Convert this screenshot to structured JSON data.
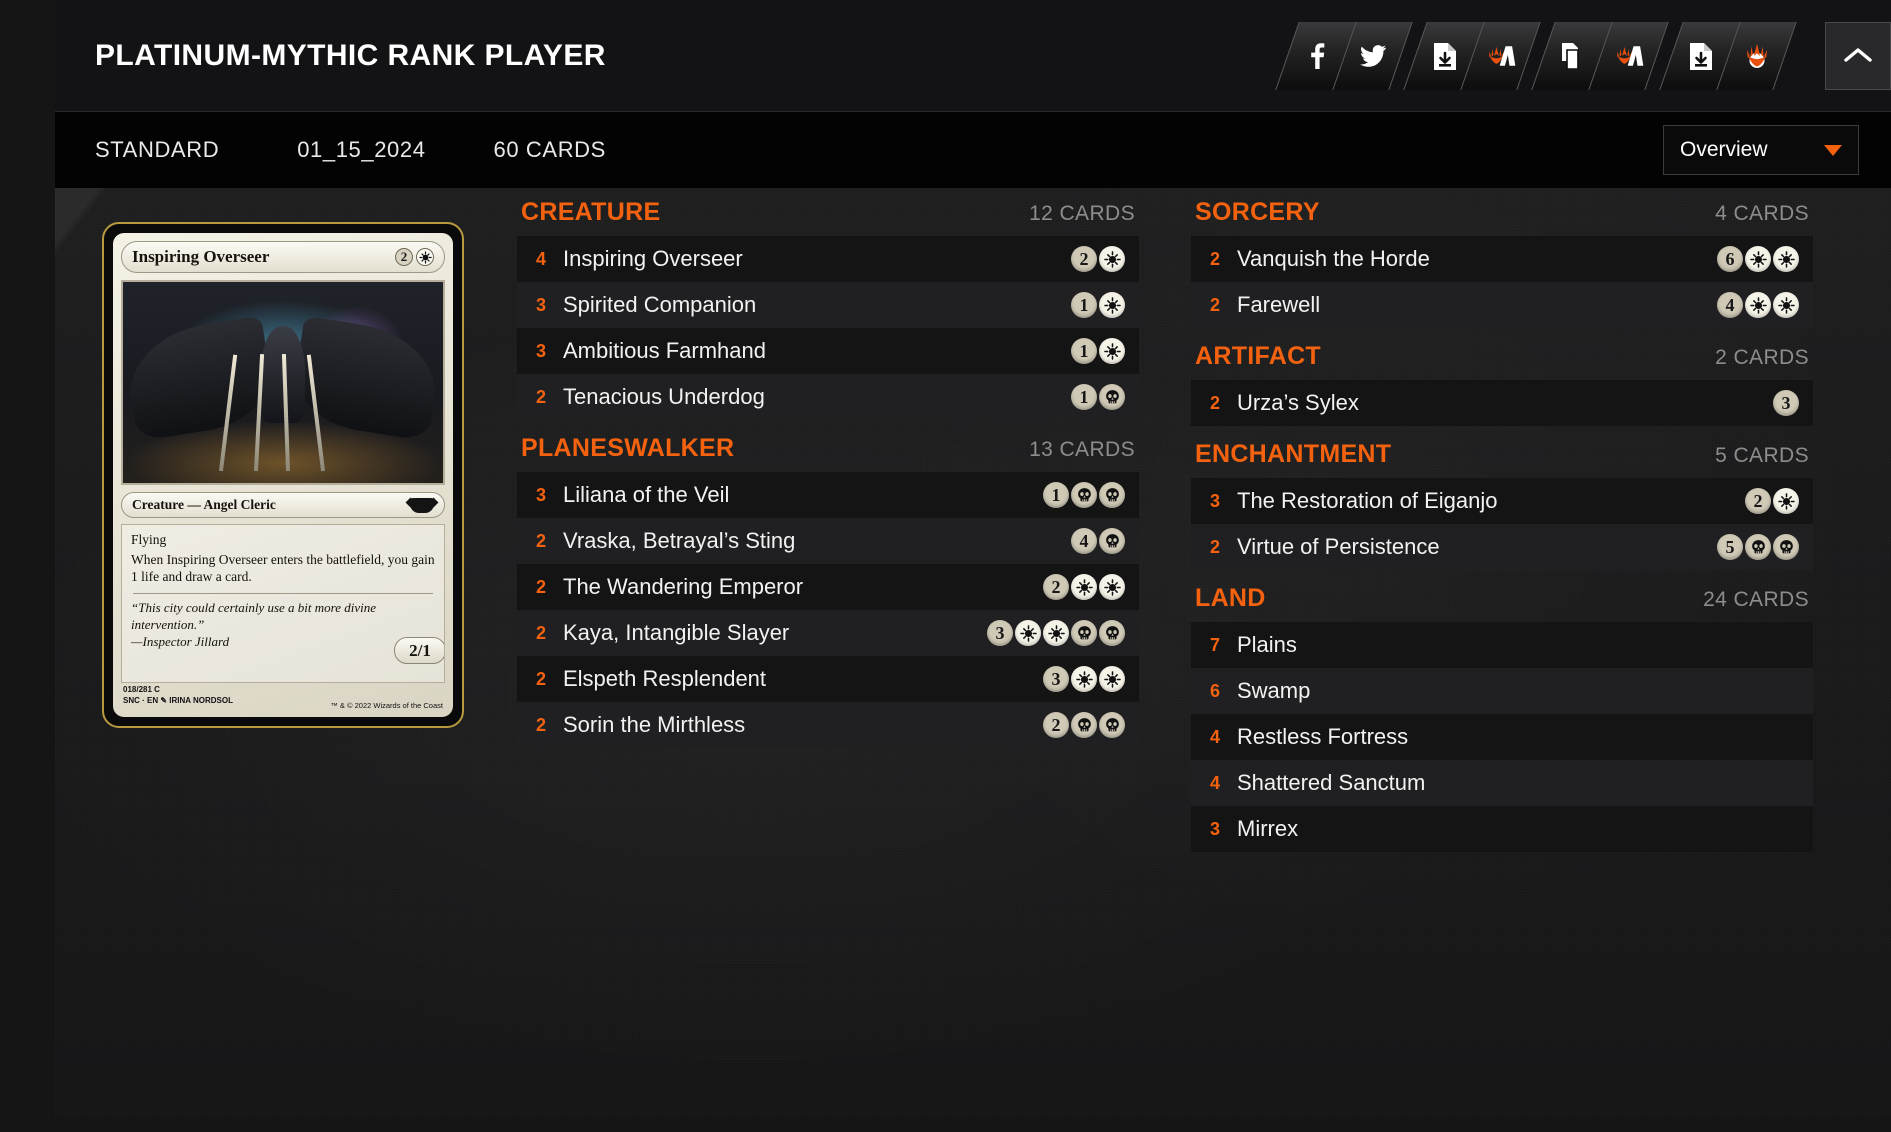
{
  "colors": {
    "accent": "#f4620f",
    "title_text": "#ffffff",
    "count_text": "#8d8d8d",
    "row_dark": "#141415",
    "row_light": "#202022",
    "titlebar_bg": "#131315",
    "metabar_bg": "#030303",
    "card_border": "#b8993f"
  },
  "header": {
    "title": "PLATINUM-MYTHIC RANK PLAYER",
    "icons": [
      {
        "name": "facebook-share-icon",
        "glyph": "facebook"
      },
      {
        "name": "twitter-share-icon",
        "glyph": "twitter"
      },
      {
        "name": "export-deck-file-icon",
        "glyph": "file-download"
      },
      {
        "name": "mtg-arena-import-icon",
        "glyph": "mtg-planeswalker"
      },
      {
        "name": "copy-decklist-icon",
        "glyph": "copy"
      },
      {
        "name": "mtg-arena-copy-icon",
        "glyph": "mtg-planeswalker"
      },
      {
        "name": "download-decklist-icon",
        "glyph": "file-download"
      },
      {
        "name": "mtg-arena-download-icon",
        "glyph": "mtg-planeswalker-flame"
      }
    ],
    "collapse_label": "collapse-panel"
  },
  "meta": {
    "format": "STANDARD",
    "date": "01_15_2024",
    "card_count": "60 CARDS",
    "view_selected": "Overview",
    "view_options": [
      "Overview"
    ]
  },
  "preview_card": {
    "name": "Inspiring Overseer",
    "mana_cost": [
      {
        "type": "generic",
        "value": "2"
      },
      {
        "type": "white"
      }
    ],
    "type_line": "Creature — Angel Cleric",
    "rules": [
      "Flying",
      "When Inspiring Overseer enters the battlefield, you gain 1 life and draw a card."
    ],
    "flavor": "“This city could certainly use a bit more divine intervention.”",
    "flavor_attribution": "—Inspector Jillard",
    "power_toughness": "2/1",
    "collector_number": "018/281",
    "rarity": "C",
    "set_lang": "SNC · EN",
    "artist": "IRINA NORDSOL",
    "copyright": "™ & © 2022 Wizards of the Coast"
  },
  "columns": [
    {
      "sections": [
        {
          "title": "CREATURE",
          "count": "12 CARDS",
          "cards": [
            {
              "qty": "4",
              "name": "Inspiring Overseer",
              "cost": [
                {
                  "type": "generic",
                  "value": "2"
                },
                {
                  "type": "white"
                }
              ]
            },
            {
              "qty": "3",
              "name": "Spirited Companion",
              "cost": [
                {
                  "type": "generic",
                  "value": "1"
                },
                {
                  "type": "white"
                }
              ]
            },
            {
              "qty": "3",
              "name": "Ambitious Farmhand",
              "cost": [
                {
                  "type": "generic",
                  "value": "1"
                },
                {
                  "type": "white"
                }
              ]
            },
            {
              "qty": "2",
              "name": "Tenacious Underdog",
              "cost": [
                {
                  "type": "generic",
                  "value": "1"
                },
                {
                  "type": "black"
                }
              ]
            }
          ]
        },
        {
          "title": "PLANESWALKER",
          "count": "13 CARDS",
          "cards": [
            {
              "qty": "3",
              "name": "Liliana of the Veil",
              "cost": [
                {
                  "type": "generic",
                  "value": "1"
                },
                {
                  "type": "black"
                },
                {
                  "type": "black"
                }
              ]
            },
            {
              "qty": "2",
              "name": "Vraska, Betrayal’s Sting",
              "cost": [
                {
                  "type": "generic",
                  "value": "4"
                },
                {
                  "type": "black"
                }
              ]
            },
            {
              "qty": "2",
              "name": "The Wandering Emperor",
              "cost": [
                {
                  "type": "generic",
                  "value": "2"
                },
                {
                  "type": "white"
                },
                {
                  "type": "white"
                }
              ]
            },
            {
              "qty": "2",
              "name": "Kaya, Intangible Slayer",
              "cost": [
                {
                  "type": "generic",
                  "value": "3"
                },
                {
                  "type": "white"
                },
                {
                  "type": "white"
                },
                {
                  "type": "black"
                },
                {
                  "type": "black"
                }
              ]
            },
            {
              "qty": "2",
              "name": "Elspeth Resplendent",
              "cost": [
                {
                  "type": "generic",
                  "value": "3"
                },
                {
                  "type": "white"
                },
                {
                  "type": "white"
                }
              ]
            },
            {
              "qty": "2",
              "name": "Sorin the Mirthless",
              "cost": [
                {
                  "type": "generic",
                  "value": "2"
                },
                {
                  "type": "black"
                },
                {
                  "type": "black"
                }
              ]
            }
          ]
        }
      ]
    },
    {
      "sections": [
        {
          "title": "SORCERY",
          "count": "4 CARDS",
          "cards": [
            {
              "qty": "2",
              "name": "Vanquish the Horde",
              "cost": [
                {
                  "type": "generic",
                  "value": "6"
                },
                {
                  "type": "white"
                },
                {
                  "type": "white"
                }
              ]
            },
            {
              "qty": "2",
              "name": "Farewell",
              "cost": [
                {
                  "type": "generic",
                  "value": "4"
                },
                {
                  "type": "white"
                },
                {
                  "type": "white"
                }
              ]
            }
          ]
        },
        {
          "title": "ARTIFACT",
          "count": "2 CARDS",
          "cards": [
            {
              "qty": "2",
              "name": "Urza’s Sylex",
              "cost": [
                {
                  "type": "generic",
                  "value": "3"
                }
              ]
            }
          ]
        },
        {
          "title": "ENCHANTMENT",
          "count": "5 CARDS",
          "cards": [
            {
              "qty": "3",
              "name": "The Restoration of Eiganjo",
              "cost": [
                {
                  "type": "generic",
                  "value": "2"
                },
                {
                  "type": "white"
                }
              ]
            },
            {
              "qty": "2",
              "name": "Virtue of Persistence",
              "cost": [
                {
                  "type": "generic",
                  "value": "5"
                },
                {
                  "type": "black"
                },
                {
                  "type": "black"
                }
              ]
            }
          ]
        },
        {
          "title": "LAND",
          "count": "24 CARDS",
          "cards": [
            {
              "qty": "7",
              "name": "Plains",
              "cost": []
            },
            {
              "qty": "6",
              "name": "Swamp",
              "cost": []
            },
            {
              "qty": "4",
              "name": "Restless Fortress",
              "cost": []
            },
            {
              "qty": "4",
              "name": "Shattered Sanctum",
              "cost": []
            },
            {
              "qty": "3",
              "name": "Mirrex",
              "cost": []
            }
          ]
        }
      ]
    }
  ]
}
